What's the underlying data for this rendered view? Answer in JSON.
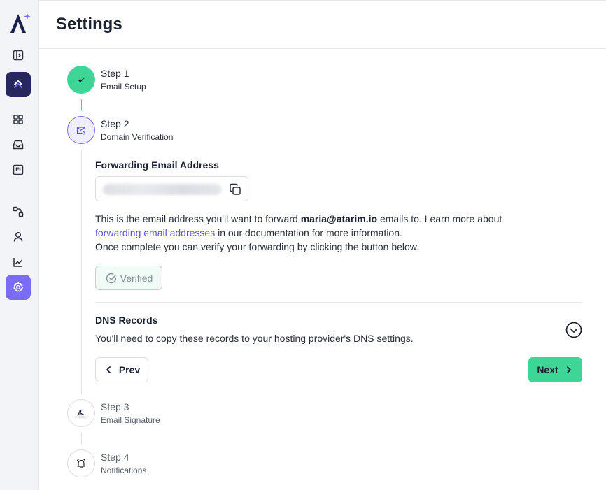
{
  "page": {
    "title": "Settings"
  },
  "sidebar": {
    "logo": "atarim-logo",
    "items": [
      {
        "icon": "sidebar-toggle-icon",
        "active": false
      },
      {
        "icon": "chevrons-up-icon",
        "active": true
      },
      {
        "icon": "grid-icon",
        "active": false
      },
      {
        "icon": "inbox-icon",
        "active": false
      },
      {
        "icon": "kanban-icon",
        "active": false
      },
      {
        "icon": "workflow-icon",
        "active": false
      },
      {
        "icon": "user-icon",
        "active": false
      },
      {
        "icon": "chart-line-icon",
        "active": false
      },
      {
        "icon": "gear-icon",
        "active": true
      }
    ]
  },
  "steps": [
    {
      "title": "Step 1",
      "subtitle": "Email Setup",
      "status": "done"
    },
    {
      "title": "Step 2",
      "subtitle": "Domain Verification",
      "status": "active"
    },
    {
      "title": "Step 3",
      "subtitle": "Email Signature",
      "status": "pending"
    },
    {
      "title": "Step 4",
      "subtitle": "Notifications",
      "status": "pending"
    }
  ],
  "forwarding": {
    "label": "Forwarding Email Address",
    "value": "",
    "desc_prefix": "This is the email address you'll want to forward ",
    "desc_email": "maria@atarim.io",
    "desc_suffix": " emails to. Learn more about",
    "link_text": "forwarding email addresses",
    "link_suffix": " in our documentation for more information.",
    "desc_line3": "Once complete you can verify your forwarding by clicking the button below.",
    "verified_label": "Verified"
  },
  "dns": {
    "label": "DNS Records",
    "desc": "You'll need to copy these records to your hosting provider's DNS settings."
  },
  "nav": {
    "prev_label": "Prev",
    "next_label": "Next"
  },
  "colors": {
    "accent": "#7b6cf6",
    "success": "#3ed696",
    "dark": "#27275e"
  }
}
